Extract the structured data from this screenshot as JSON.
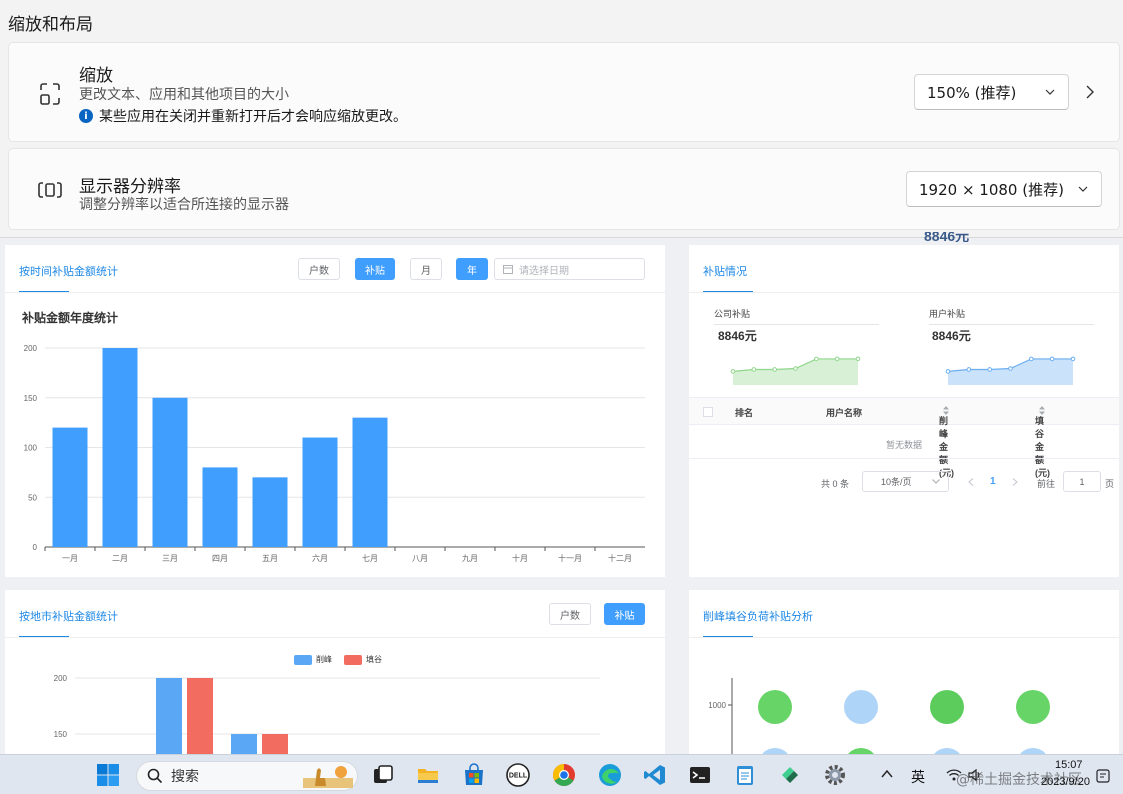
{
  "settings": {
    "section_title": "缩放和布局",
    "scale": {
      "title": "缩放",
      "desc": "更改文本、应用和其他项目的大小",
      "note": "某些应用在关闭并重新打开后才会响应缩放更改。",
      "value": "150% (推荐)"
    },
    "resolution": {
      "title": "显示器分辨率",
      "desc": "调整分辨率以适合所连接的显示器",
      "value": "1920 × 1080 (推荐)"
    },
    "background_peek": "8846元"
  },
  "time_panel": {
    "title": "按时间补贴金额统计",
    "buttons": {
      "households": "户数",
      "subsidy": "补贴",
      "month": "月",
      "year": "年"
    },
    "date_placeholder": "请选择日期",
    "chart_title": "补贴金额年度统计"
  },
  "subsidy_panel": {
    "title": "补贴情况",
    "company_label": "公司补贴",
    "company_value": "8846元",
    "user_label": "用户补贴",
    "user_value": "8846元",
    "table_headers": [
      "排名",
      "用户名称",
      "削峰金额(元)",
      "填谷金额(元)"
    ],
    "empty_text": "暂无数据",
    "pagination": {
      "total": "共 0 条",
      "page_size": "10条/页",
      "current_page": "1",
      "goto_label": "前往",
      "goto_value": "1",
      "page_unit": "页"
    }
  },
  "city_panel": {
    "title": "按地市补贴金额统计",
    "buttons": {
      "households": "户数",
      "subsidy": "补贴"
    },
    "legend": [
      "削峰",
      "填谷"
    ]
  },
  "peak_panel": {
    "title": "削峰填谷负荷补贴分析"
  },
  "taskbar": {
    "search_label": "搜索",
    "ime": "英",
    "time": "15:07",
    "date": "2023/9/20",
    "watermark": "@稀土掘金技术社区"
  },
  "chart_data": [
    {
      "type": "bar",
      "title": "补贴金额年度统计",
      "categories": [
        "一月",
        "二月",
        "三月",
        "四月",
        "五月",
        "六月",
        "七月",
        "八月",
        "九月",
        "十月",
        "十一月",
        "十二月"
      ],
      "values": [
        120,
        200,
        150,
        80,
        70,
        110,
        130,
        0,
        0,
        0,
        0,
        0
      ],
      "yticks": [
        0,
        50,
        100,
        150,
        200
      ],
      "ylim": [
        0,
        200
      ],
      "color": "#409eff"
    },
    {
      "type": "bar",
      "series": [
        {
          "name": "削峰",
          "color": "#5aa8f5",
          "values": [
            200,
            150
          ]
        },
        {
          "name": "填谷",
          "color": "#f26c5f",
          "values": [
            200,
            150
          ]
        }
      ],
      "yticks": [
        150,
        200
      ],
      "ylim": [
        100,
        200
      ]
    },
    {
      "type": "area",
      "title": "公司补贴",
      "values": [
        3,
        3.2,
        3.2,
        3.3,
        4.3,
        4.3,
        4.3
      ],
      "color": "#8fd68a"
    },
    {
      "type": "area",
      "title": "用户补贴",
      "values": [
        3,
        3.2,
        3.2,
        3.3,
        4.3,
        4.3,
        4.3
      ],
      "color": "#6aaef0"
    },
    {
      "type": "scatter",
      "yticks": [
        1000
      ],
      "points": [
        {
          "col": 1,
          "row": 1,
          "color": "#66d466"
        },
        {
          "col": 2,
          "row": 1,
          "color": "#aed4f8"
        },
        {
          "col": 3,
          "row": 1,
          "color": "#5ccc5c"
        },
        {
          "col": 4,
          "row": 1,
          "color": "#66d466"
        },
        {
          "col": 1,
          "row": 2,
          "color": "#aed4f8"
        },
        {
          "col": 2,
          "row": 2,
          "color": "#66d466"
        },
        {
          "col": 3,
          "row": 2,
          "color": "#aed4f8"
        },
        {
          "col": 4,
          "row": 2,
          "color": "#aed4f8"
        }
      ]
    }
  ]
}
